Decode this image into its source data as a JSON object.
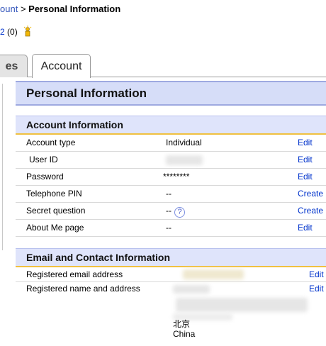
{
  "breadcrumb": {
    "parent": "ount",
    "separator": ">",
    "current": "Personal Information"
  },
  "feedback": {
    "score": "2",
    "count": "(0)",
    "icon": "star-icon"
  },
  "tabs": [
    {
      "label": "es"
    },
    {
      "label": "Account"
    }
  ],
  "page": {
    "title": "Personal Information"
  },
  "account_section": {
    "title": "Account Information",
    "rows": [
      {
        "label": "Account type",
        "value": "Individual",
        "action": "Edit"
      },
      {
        "label": "User ID",
        "value": "",
        "action": "Edit"
      },
      {
        "label": "Password",
        "value": "********",
        "action": "Edit"
      },
      {
        "label": "Telephone PIN",
        "value": "--",
        "action": "Create"
      },
      {
        "label": "Secret question",
        "value": "--",
        "help": "?",
        "action": "Create"
      },
      {
        "label": "About Me page",
        "value": "--",
        "action": "Edit"
      }
    ]
  },
  "contact_section": {
    "title": "Email and Contact Information",
    "email": {
      "label": "Registered email address",
      "action": "Edit"
    },
    "address": {
      "label": "Registered name and address",
      "action": "Edit",
      "city": "北京",
      "country": "China"
    }
  },
  "colors": {
    "link": "#0033cc",
    "header_bg": "#d6ddf8",
    "section_bg": "#dfe4fb",
    "section_rule": "#f0c040"
  }
}
